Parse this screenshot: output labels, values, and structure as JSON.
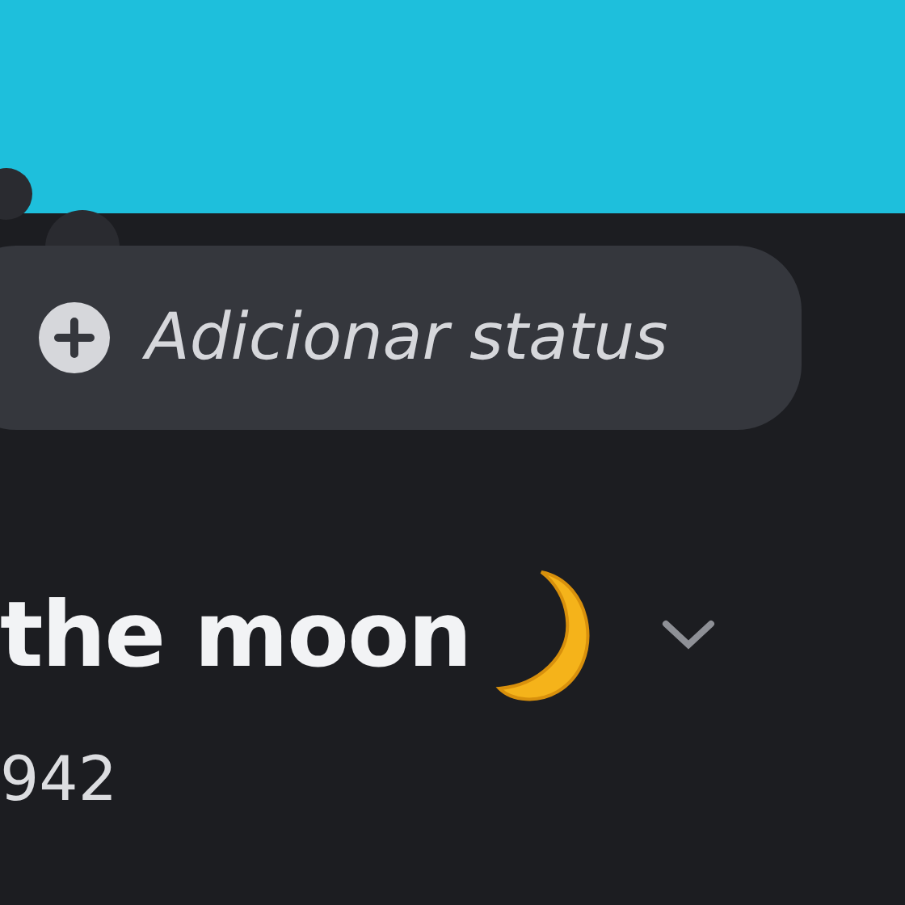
{
  "status_bubble": {
    "label": "Adicionar status"
  },
  "profile": {
    "display_name": "the moon",
    "username": "942"
  }
}
